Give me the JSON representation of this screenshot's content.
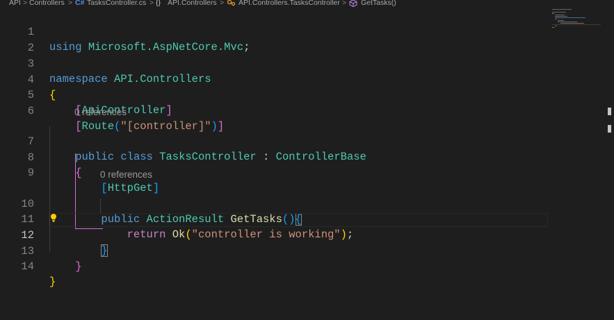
{
  "breadcrumb": {
    "seg1": "API",
    "seg2": "Controllers",
    "file_icon": "C#",
    "file": "TasksController.cs",
    "ns_icon": "{}",
    "ns": "API.Controllers",
    "class": "API.Controllers.TasksController",
    "method": "GetTasks()",
    "separator": ">"
  },
  "icons": {
    "file": "csharp-file-icon",
    "namespace": "namespace-braces-icon",
    "class": "class-icon",
    "method": "method-cube-icon",
    "lightbulb": "lightbulb-icon"
  },
  "editor": {
    "line_numbers": [
      "1",
      "2",
      "3",
      "4",
      "5",
      "6",
      "7",
      "8",
      "9",
      "10",
      "11",
      "12",
      "13",
      "14"
    ],
    "codelens_references": "0 references",
    "code": {
      "l1_using": "using",
      "l1_ns": "Microsoft.AspNetCore.Mvc",
      "semicolon": ";",
      "l3_kw": "namespace",
      "l3_ns": "API.Controllers",
      "brace_open": "{",
      "brace_close": "}",
      "bracket_open": "[",
      "bracket_close": "]",
      "l5_attr": "ApiController",
      "l6_attr": "Route",
      "paren_open": "(",
      "paren_close": ")",
      "l6_str": "\"[controller]\"",
      "l7_public": "public",
      "l7_class": "class",
      "l7_name": "TasksController",
      "colon": ":",
      "l7_base": "ControllerBase",
      "l9_attr": "HttpGet",
      "l10_public": "public",
      "l10_type": "ActionResult",
      "l10_fn": "GetTasks",
      "l11_return": "return",
      "l11_fn": "Ok",
      "l11_str": "\"controller is working\""
    }
  },
  "colors": {
    "background": "#1e1e1e",
    "keyword": "#569cd6",
    "control_keyword": "#c586c0",
    "type": "#4ec9b0",
    "function": "#dcdcaa",
    "string": "#ce9178",
    "bracket_level1": "#ffd700",
    "bracket_level2": "#da70d6",
    "bracket_level3": "#179fff"
  }
}
